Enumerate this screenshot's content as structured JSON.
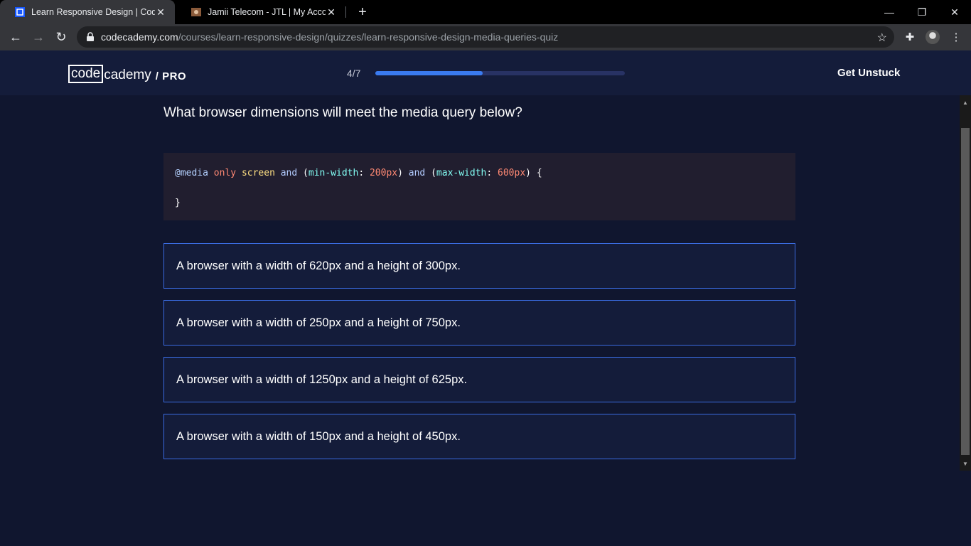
{
  "browser": {
    "tabs": [
      {
        "title": "Learn Responsive Design | Codec",
        "active": true
      },
      {
        "title": "Jamii Telecom - JTL | My Account",
        "active": false
      }
    ],
    "url_domain": "codecademy.com",
    "url_path": "/courses/learn-responsive-design/quizzes/learn-responsive-design-media-queries-quiz"
  },
  "header": {
    "logo_code": "code",
    "logo_cademy": "cademy",
    "logo_pro": "/ PRO",
    "progress_text": "4/7",
    "progress_fraction": 0.43,
    "get_unstuck": "Get Unstuck"
  },
  "quiz": {
    "question": "What browser dimensions will meet the media query below?",
    "code": {
      "at": "@media",
      "only": "only",
      "screen": "screen",
      "and1": "and",
      "open1": "(",
      "minprop": "min-width",
      "colon1": ":",
      "minval": "200px",
      "close1": ")",
      "and2": "and",
      "open2": "(",
      "maxprop": "max-width",
      "colon2": ":",
      "maxval": "600px",
      "close2": ")",
      "brace_open": "{",
      "brace_close": "}"
    },
    "choices": [
      "A browser with a width of 620px and a height of 300px.",
      "A browser with a width of 250px and a height of 750px.",
      "A browser with a width of 1250px and a height of 625px.",
      "A browser with a width of 150px and a height of 450px."
    ]
  },
  "colors": {
    "accent": "#3a7bf0",
    "background": "#10162f"
  }
}
